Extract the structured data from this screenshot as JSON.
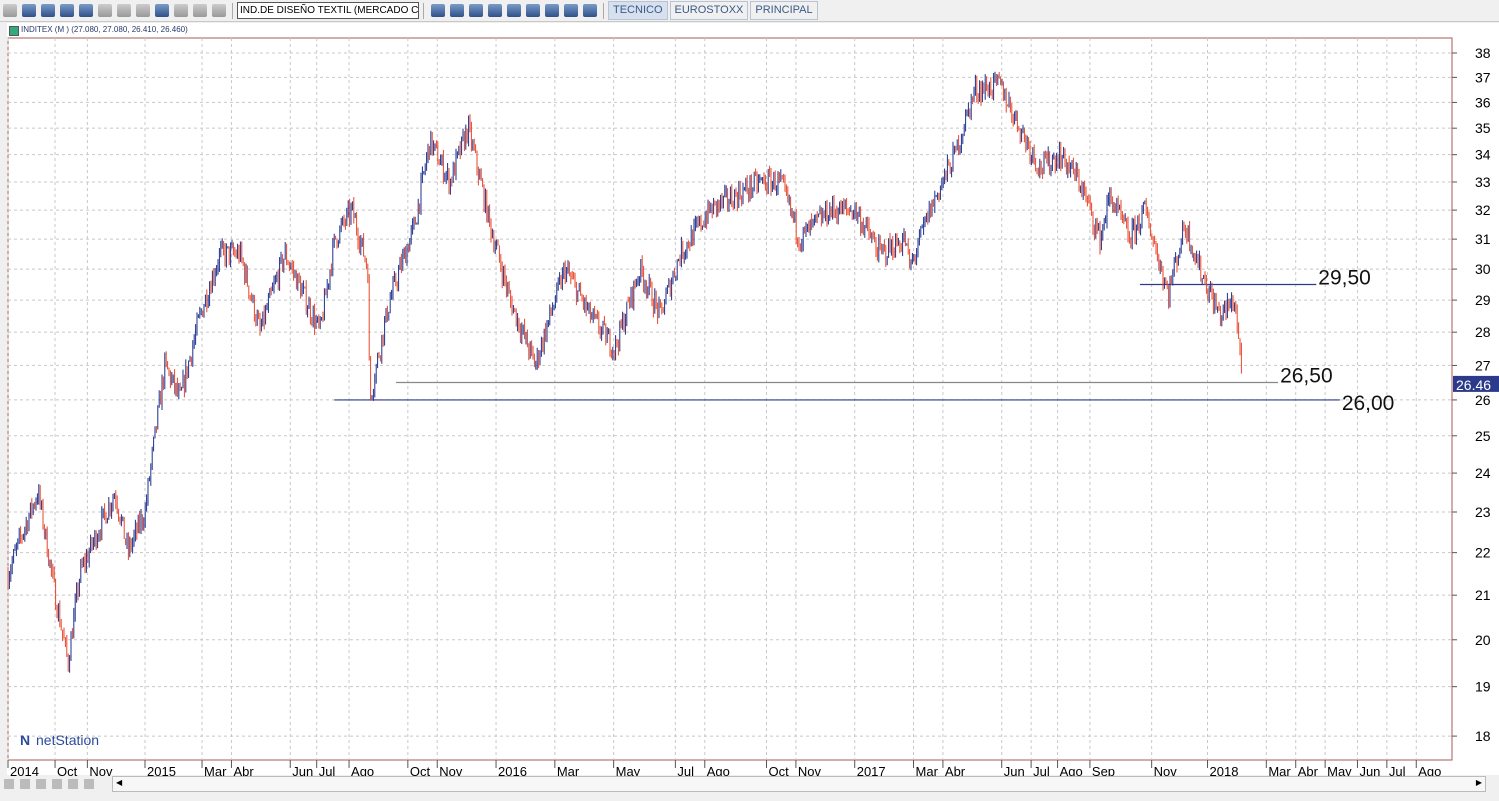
{
  "toolbar": {
    "symbol_field": "IND.DE DISEÑO TEXTIL (MERCADO CONTIN",
    "tabs": [
      "TECNICO",
      "EUROSTOXX",
      "PRINCIPAL"
    ]
  },
  "header": {
    "title": "INDITEX (M ) (27.080, 27.080, 26.410, 26.460)"
  },
  "logo": "netStation",
  "colors": {
    "up": "#1c2f8c",
    "down": "#e8462a",
    "grid": "#c8c8c8",
    "frame": "#a85858",
    "price_tag": "#2b3a8a"
  },
  "chart_data": {
    "type": "ohlc-bar",
    "title": "INDITEX (M )",
    "y_scale": "log",
    "ylim": [
      17.5,
      39
    ],
    "yticks": [
      18,
      19,
      20,
      21,
      22,
      23,
      24,
      25,
      26,
      27,
      28,
      29,
      30,
      31,
      32,
      33,
      34,
      35,
      36,
      37,
      38
    ],
    "x_origin": "2014-09",
    "x_unit": "months",
    "xticks": [
      {
        "m": 0,
        "label": "2014"
      },
      {
        "m": 1.6,
        "label": "Oct"
      },
      {
        "m": 2.7,
        "label": "Nov"
      },
      {
        "m": 4.66,
        "label": "2015"
      },
      {
        "m": 6.6,
        "label": "Mar"
      },
      {
        "m": 7.6,
        "label": "Abr"
      },
      {
        "m": 9.6,
        "label": "Jun"
      },
      {
        "m": 10.5,
        "label": "Jul"
      },
      {
        "m": 11.6,
        "label": "Ago"
      },
      {
        "m": 13.6,
        "label": "Oct"
      },
      {
        "m": 14.6,
        "label": "Nov"
      },
      {
        "m": 16.6,
        "label": "2016"
      },
      {
        "m": 18.6,
        "label": "Mar"
      },
      {
        "m": 20.6,
        "label": "May"
      },
      {
        "m": 22.7,
        "label": "Jul"
      },
      {
        "m": 23.7,
        "label": "Ago"
      },
      {
        "m": 25.8,
        "label": "Oct"
      },
      {
        "m": 26.8,
        "label": "Nov"
      },
      {
        "m": 28.8,
        "label": "2017"
      },
      {
        "m": 30.8,
        "label": "Mar"
      },
      {
        "m": 31.8,
        "label": "Abr"
      },
      {
        "m": 33.8,
        "label": "Jun"
      },
      {
        "m": 34.8,
        "label": "Jul"
      },
      {
        "m": 35.7,
        "label": "Ago"
      },
      {
        "m": 36.8,
        "label": "Sep"
      },
      {
        "m": 38.9,
        "label": "Nov"
      },
      {
        "m": 40.8,
        "label": "2018"
      },
      {
        "m": 42.8,
        "label": "Mar"
      },
      {
        "m": 43.8,
        "label": "Abr"
      },
      {
        "m": 44.8,
        "label": "May"
      },
      {
        "m": 45.9,
        "label": "Jun"
      },
      {
        "m": 46.9,
        "label": "Jul"
      },
      {
        "m": 47.9,
        "label": "Ago"
      }
    ],
    "price_path": [
      [
        0,
        21.5
      ],
      [
        1.02,
        23.5
      ],
      [
        1.6,
        21
      ],
      [
        2.04,
        19.5
      ],
      [
        2.45,
        21.5
      ],
      [
        3.64,
        23.5
      ],
      [
        4.08,
        22
      ],
      [
        4.66,
        23
      ],
      [
        5.34,
        27
      ],
      [
        5.85,
        26
      ],
      [
        6.53,
        28.5
      ],
      [
        7.21,
        30.5
      ],
      [
        7.89,
        30.5
      ],
      [
        8.57,
        28
      ],
      [
        9.42,
        30.5
      ],
      [
        10.61,
        28
      ],
      [
        11.12,
        31
      ],
      [
        11.7,
        32
      ],
      [
        12.24,
        30
      ],
      [
        12.3,
        26
      ],
      [
        12.99,
        29
      ],
      [
        13.84,
        31.5
      ],
      [
        14.35,
        34.5
      ],
      [
        15.03,
        33
      ],
      [
        15.65,
        35
      ],
      [
        16.39,
        31.5
      ],
      [
        17.07,
        29
      ],
      [
        17.93,
        27
      ],
      [
        18.27,
        28
      ],
      [
        18.95,
        30
      ],
      [
        19.8,
        28.5
      ],
      [
        20.65,
        27.5
      ],
      [
        21.5,
        30
      ],
      [
        22.18,
        28.5
      ],
      [
        22.86,
        30.5
      ],
      [
        23.88,
        32
      ],
      [
        25.58,
        33
      ],
      [
        26.26,
        33
      ],
      [
        26.94,
        31
      ],
      [
        27.96,
        32
      ],
      [
        28.81,
        32
      ],
      [
        29.66,
        30.5
      ],
      [
        30.51,
        31
      ],
      [
        30.68,
        30
      ],
      [
        31.36,
        32
      ],
      [
        32.21,
        34
      ],
      [
        32.89,
        36.5
      ],
      [
        33.74,
        36.7
      ],
      [
        34.42,
        35
      ],
      [
        35.1,
        33.5
      ],
      [
        35.78,
        34
      ],
      [
        36.46,
        33
      ],
      [
        37.14,
        31
      ],
      [
        37.48,
        32.5
      ],
      [
        38.16,
        31
      ],
      [
        38.67,
        32
      ],
      [
        39.46,
        29.2
      ],
      [
        40.03,
        31.5
      ],
      [
        40.54,
        30
      ],
      [
        41.22,
        28.5
      ],
      [
        41.73,
        29
      ],
      [
        42.0,
        26.46
      ]
    ],
    "last_price": "26.46",
    "levels": [
      {
        "value": 29.5,
        "label": "29,50",
        "from": 38.5,
        "to": 44.5,
        "color": "#2b3a8a"
      },
      {
        "value": 26.5,
        "label": "26,50",
        "from": 13.2,
        "to": 43.2,
        "color": "#888888"
      },
      {
        "value": 26.0,
        "label": "26,00",
        "from": 11.1,
        "to": 45.3,
        "color": "#2b3a8a"
      }
    ]
  }
}
